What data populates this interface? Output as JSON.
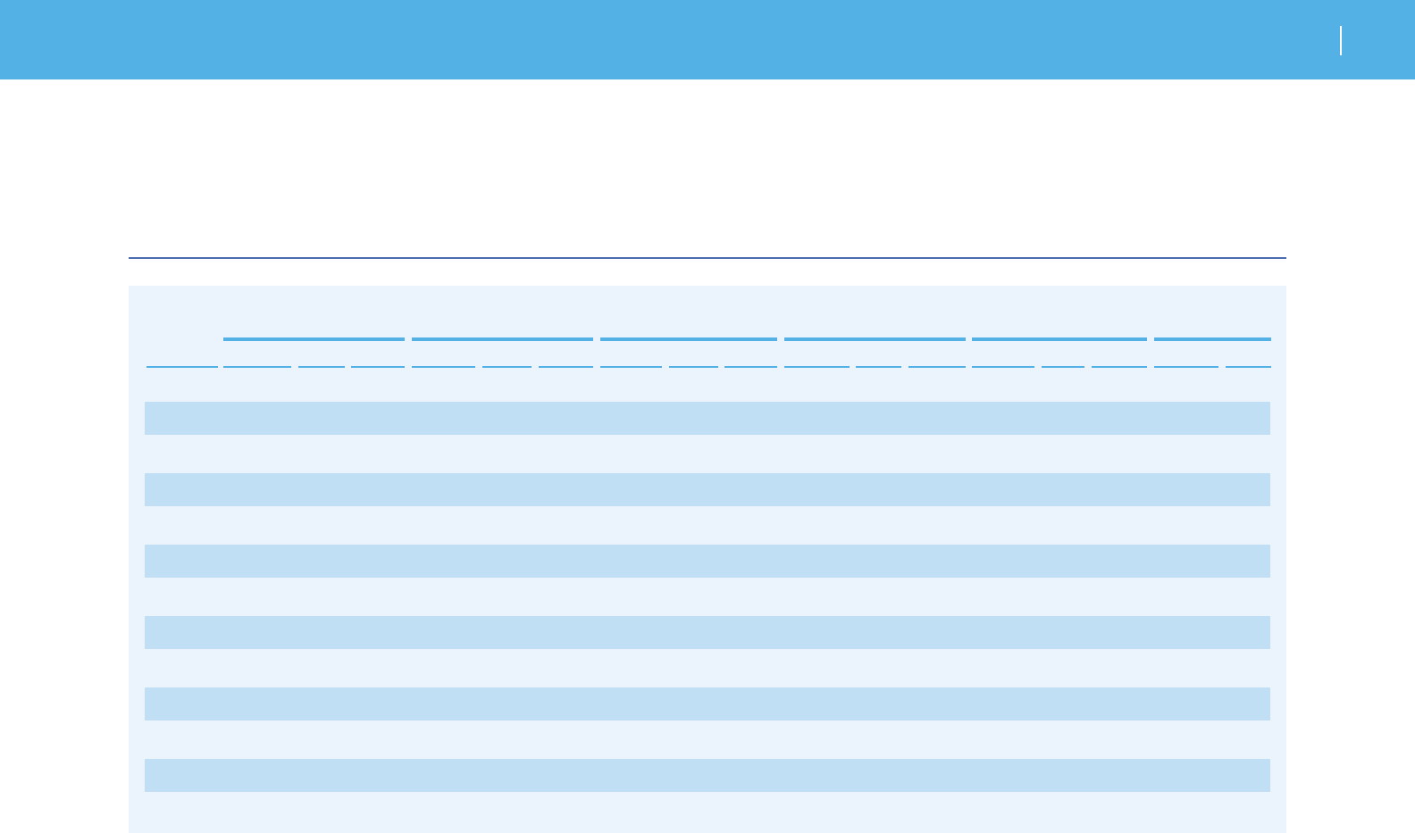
{
  "theme": {
    "header_color": "#53b1e5",
    "rule_color": "#4a6bb0",
    "panel_color": "#ebf4fc",
    "band_color": "#c0dff5",
    "column_rule_color": "#53b1e5"
  },
  "header": {
    "divider_icon": "vertical-divider"
  },
  "table": {
    "group_header_count": 6,
    "column_count": 18,
    "banded_row_count": 6
  }
}
